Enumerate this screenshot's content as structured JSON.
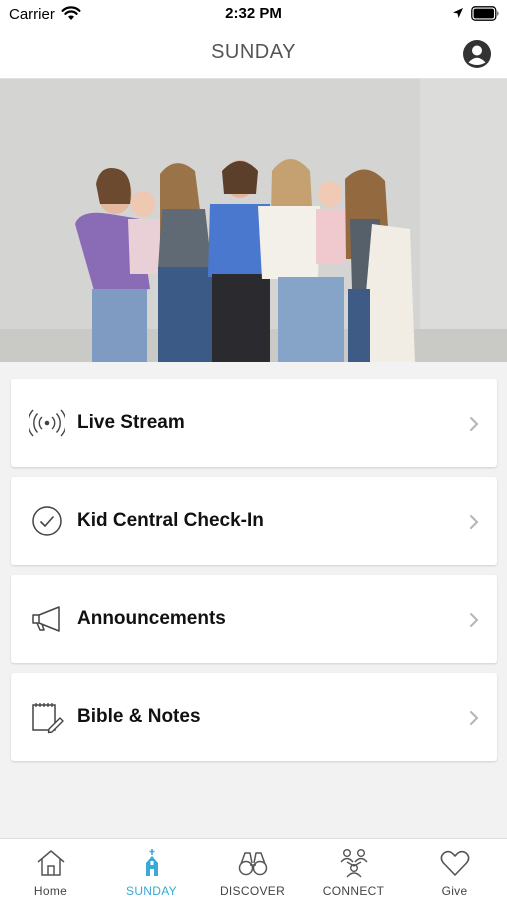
{
  "status_bar": {
    "carrier": "Carrier",
    "time": "2:32 PM"
  },
  "header": {
    "title": "SUNDAY"
  },
  "hero": {
    "description_icon": "photo"
  },
  "menu": {
    "items": [
      {
        "label": "Live Stream",
        "icon": "broadcast-icon"
      },
      {
        "label": "Kid Central Check-In",
        "icon": "check-circle-icon"
      },
      {
        "label": "Announcements",
        "icon": "megaphone-icon"
      },
      {
        "label": "Bible & Notes",
        "icon": "notepad-pen-icon"
      }
    ]
  },
  "tab_bar": {
    "tabs": [
      {
        "label": "Home",
        "icon": "house-icon"
      },
      {
        "label": "SUNDAY",
        "icon": "church-icon",
        "active": true
      },
      {
        "label": "DISCOVER",
        "icon": "binoculars-icon"
      },
      {
        "label": "CONNECT",
        "icon": "people-icon"
      },
      {
        "label": "Give",
        "icon": "heart-icon"
      }
    ]
  },
  "colors": {
    "accent": "#3aa9d6",
    "background": "#f2f2f2",
    "card": "#ffffff"
  }
}
